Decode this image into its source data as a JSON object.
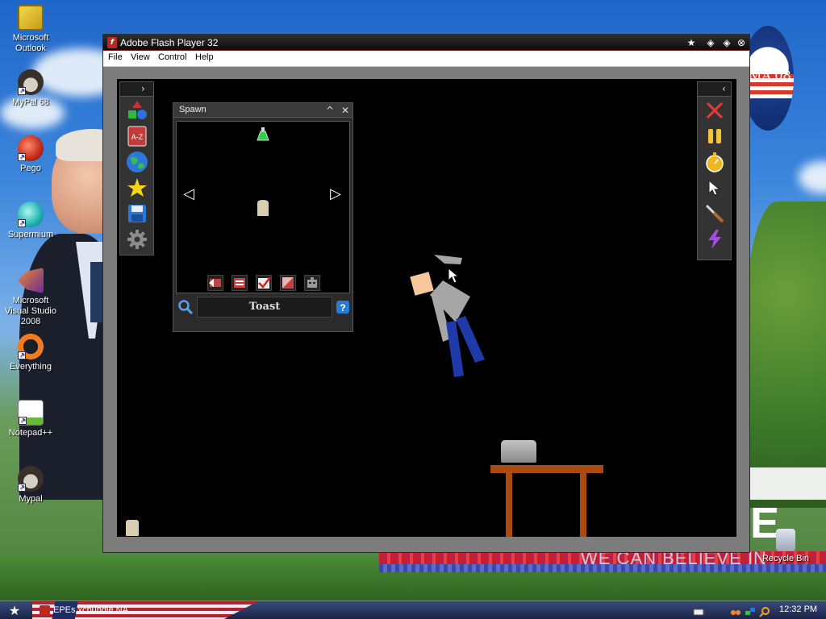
{
  "desktop": {
    "icons": [
      {
        "label": "Microsoft Outlook",
        "icon": "outlook-icon"
      },
      {
        "label": "MyPal 68",
        "icon": "mypal-icon"
      },
      {
        "label": "Pego",
        "icon": "pego-icon"
      },
      {
        "label": "Supermium",
        "icon": "supermium-icon"
      },
      {
        "label": "Microsoft Visual Studio 2008",
        "icon": "visual-studio-icon"
      },
      {
        "label": "Everything",
        "icon": "everything-icon"
      },
      {
        "label": "Notepad++",
        "icon": "notepad-plus-plus-icon"
      },
      {
        "label": "Mypal",
        "icon": "mypal-icon"
      },
      {
        "label": "Recycle Bin",
        "icon": "recycle-bin-icon"
      }
    ],
    "wallpaper": {
      "obama_text": "MA'08",
      "slogan_large": "E",
      "slogan": "WE CAN BELIEVE IN"
    }
  },
  "window": {
    "title": "Adobe Flash Player 32",
    "app_icon": "flash-icon",
    "menu": [
      "File",
      "View",
      "Control",
      "Help"
    ]
  },
  "game": {
    "left_toolbar": {
      "toggle": "›",
      "tools": [
        "shapes-icon",
        "a-z-icon",
        "globe-icon",
        "star-icon",
        "save-icon",
        "gear-icon"
      ]
    },
    "right_toolbar": {
      "toggle": "‹",
      "tools": [
        "close-x-icon",
        "pause-icon",
        "stopwatch-icon",
        "cursor-icon",
        "knife-icon",
        "lightning-icon"
      ]
    },
    "spawn_panel": {
      "title": "Spawn",
      "collapse": "^",
      "close": "✕",
      "prev": "◁",
      "next": "▷",
      "top_item_icon": "flask-icon",
      "selected_item_icon": "toast-icon",
      "filters": [
        "filter-back-icon",
        "filter-sliders-icon",
        "filter-check-icon",
        "filter-diagonal-icon",
        "filter-robot-icon"
      ],
      "search_value": "Toast",
      "left_footer_icon": "search-magnifier-icon",
      "right_footer_icon": "help-icon"
    }
  },
  "taskbar": {
    "start_icon": "start-star-icon",
    "task_label": "EPEs xcbundle NA",
    "clock": "12:32 PM",
    "tray_icons": [
      "keyboard-icon",
      "binoculars-icon",
      "network-icon",
      "search-icon"
    ]
  },
  "colors": {
    "table": "#a94b10",
    "ragdoll_shirt": "#a6a6a6",
    "ragdoll_pants": "#1d3aa8",
    "ragdoll_head": "#f7c89b",
    "stage_bg": "#000000"
  }
}
